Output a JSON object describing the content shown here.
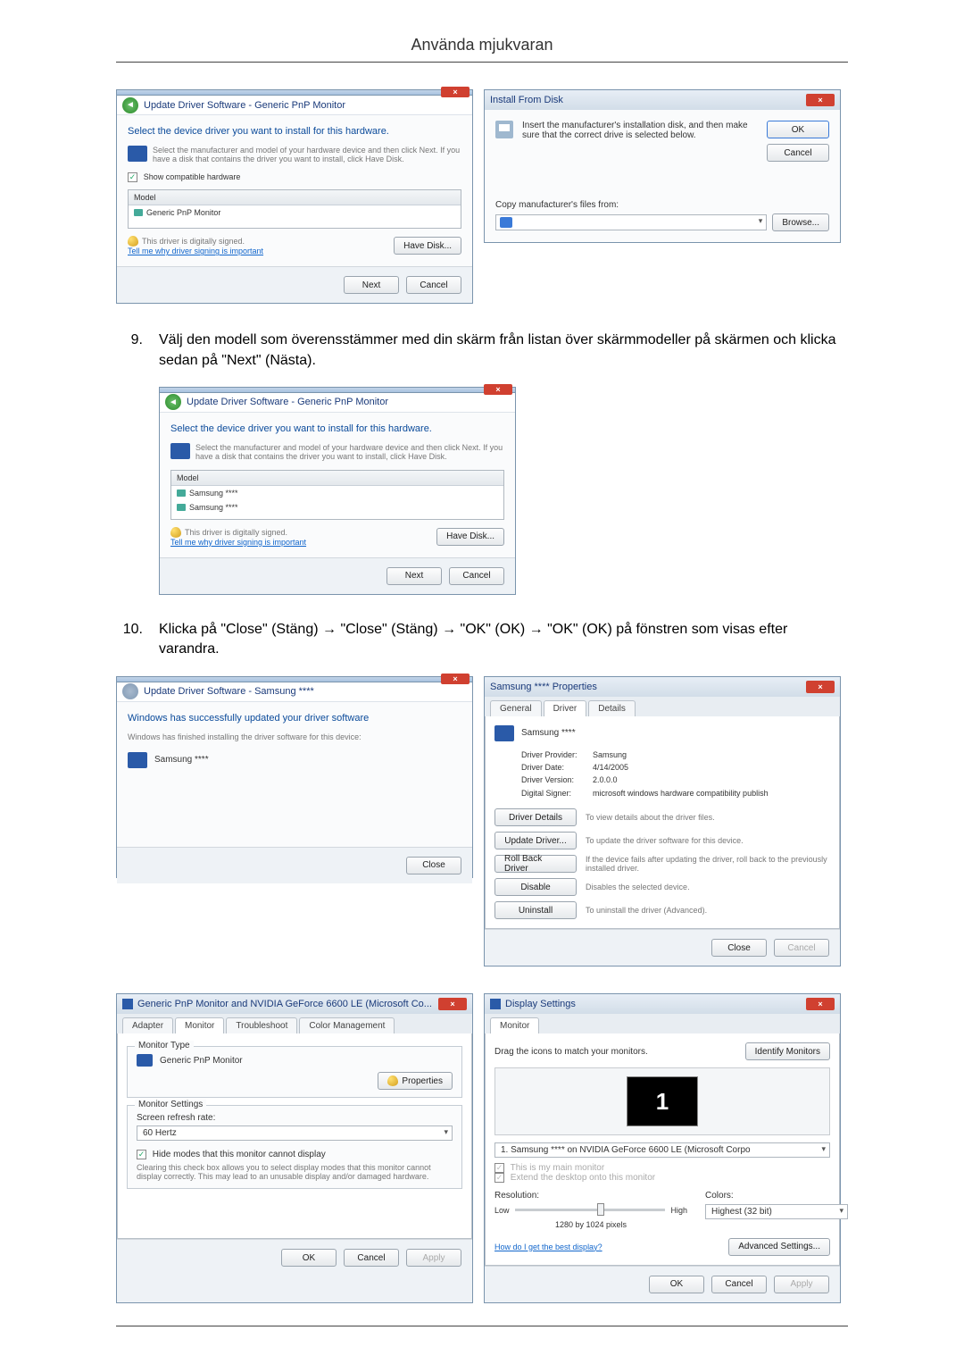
{
  "page_title": "Använda mjukvaran",
  "win_update1": {
    "title": "Update Driver Software - Generic PnP Monitor",
    "heading": "Select the device driver you want to install for this hardware.",
    "hint": "Select the manufacturer and model of your hardware device and then click Next. If you have a disk that contains the driver you want to install, click Have Disk.",
    "show_compatible": "Show compatible hardware",
    "model_col": "Model",
    "model_row": "Generic PnP Monitor",
    "signed": "This driver is digitally signed.",
    "signed_link": "Tell me why driver signing is important",
    "have_disk": "Have Disk...",
    "next": "Next",
    "cancel": "Cancel"
  },
  "win_install_disk": {
    "title": "Install From Disk",
    "text": "Insert the manufacturer's installation disk, and then make sure that the correct drive is selected below.",
    "ok": "OK",
    "cancel": "Cancel",
    "copy_label": "Copy manufacturer's files from:",
    "browse": "Browse..."
  },
  "step9": {
    "num": "9.",
    "text": "Välj den modell som överensstämmer med din skärm från listan över skärmmodeller på skärmen och klicka sedan på \"Next\" (Nästa)."
  },
  "win_update2": {
    "title": "Update Driver Software - Generic PnP Monitor",
    "heading": "Select the device driver you want to install for this hardware.",
    "hint": "Select the manufacturer and model of your hardware device and then click Next. If you have a disk that contains the driver you want to install, click Have Disk.",
    "model_col": "Model",
    "row1": "Samsung ****",
    "row2": "Samsung ****",
    "signed": "This driver is digitally signed.",
    "signed_link": "Tell me why driver signing is important",
    "have_disk": "Have Disk...",
    "next": "Next",
    "cancel": "Cancel"
  },
  "step10": {
    "num": "10.",
    "text": "Klicka på \"Close\" (Stäng) → \"Close\" (Stäng) → \"OK\" (OK) → \"OK\" (OK) på fönstren som visas efter varandra."
  },
  "win_success": {
    "title": "Update Driver Software - Samsung ****",
    "heading": "Windows has successfully updated your driver software",
    "sub": "Windows has finished installing the driver software for this device:",
    "device": "Samsung ****",
    "close": "Close"
  },
  "win_props": {
    "title": "Samsung **** Properties",
    "tabs": {
      "general": "General",
      "driver": "Driver",
      "details": "Details"
    },
    "device": "Samsung ****",
    "prov_l": "Driver Provider:",
    "prov_v": "Samsung",
    "date_l": "Driver Date:",
    "date_v": "4/14/2005",
    "ver_l": "Driver Version:",
    "ver_v": "2.0.0.0",
    "sig_l": "Digital Signer:",
    "sig_v": "microsoft windows hardware compatibility publish",
    "b_details": "Driver Details",
    "b_details_t": "To view details about the driver files.",
    "b_update": "Update Driver...",
    "b_update_t": "To update the driver software for this device.",
    "b_roll": "Roll Back Driver",
    "b_roll_t": "If the device fails after updating the driver, roll back to the previously installed driver.",
    "b_dis": "Disable",
    "b_dis_t": "Disables the selected device.",
    "b_un": "Uninstall",
    "b_un_t": "To uninstall the driver (Advanced).",
    "close": "Close",
    "cancel": "Cancel"
  },
  "win_geforce": {
    "title": "Generic PnP Monitor and NVIDIA GeForce 6600 LE (Microsoft Co...",
    "tabs": {
      "adapter": "Adapter",
      "monitor": "Monitor",
      "trouble": "Troubleshoot",
      "color": "Color Management"
    },
    "mon_type_legend": "Monitor Type",
    "mon_name": "Generic PnP Monitor",
    "properties": "Properties",
    "mon_settings_legend": "Monitor Settings",
    "refresh_label": "Screen refresh rate:",
    "refresh_val": "60 Hertz",
    "hide_label": "Hide modes that this monitor cannot display",
    "hide_text": "Clearing this check box allows you to select display modes that this monitor cannot display correctly. This may lead to an unusable display and/or damaged hardware.",
    "ok": "OK",
    "cancel": "Cancel",
    "apply": "Apply"
  },
  "win_display": {
    "title": "Display Settings",
    "tab": "Monitor",
    "drag": "Drag the icons to match your monitors.",
    "identify": "Identify Monitors",
    "device_sel": "1. Samsung **** on NVIDIA GeForce 6600 LE (Microsoft Corpo",
    "chk_main": "This is my main monitor",
    "chk_ext": "Extend the desktop onto this monitor",
    "res_l": "Resolution:",
    "low": "Low",
    "high": "High",
    "res_v": "1280 by 1024 pixels",
    "col_l": "Colors:",
    "col_v": "Highest (32 bit)",
    "best": "How do I get the best display?",
    "adv": "Advanced Settings...",
    "ok": "OK",
    "cancel": "Cancel",
    "apply": "Apply",
    "num": "1"
  }
}
